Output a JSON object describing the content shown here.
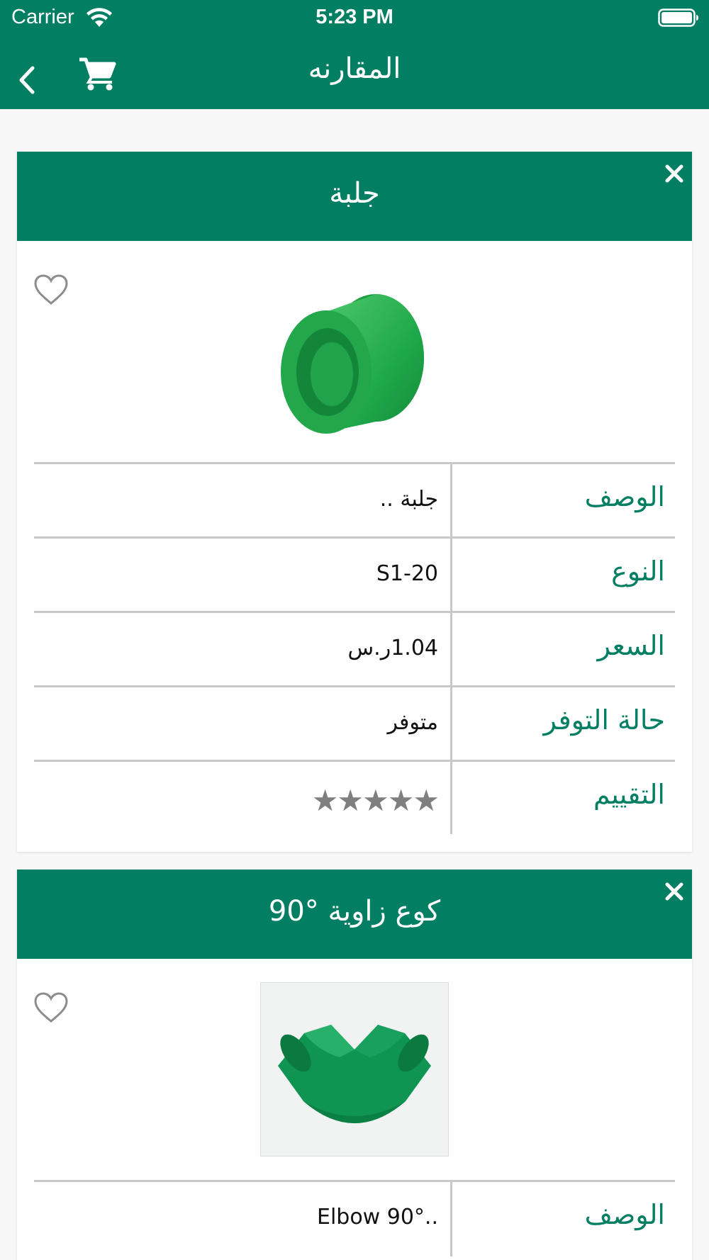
{
  "status_bar": {
    "carrier": "Carrier",
    "time": "5:23 PM"
  },
  "nav": {
    "title": "المقارنه",
    "back_icon": "chevron-left-icon",
    "cart_icon": "cart-icon"
  },
  "colors": {
    "primary": "#027e63",
    "label_text": "#027e63",
    "divider": "#c8c8c8",
    "stars": "#7f7f7f"
  },
  "products": [
    {
      "title": "جلبة",
      "close_icon": "close-icon",
      "favorite_icon": "heart-outline-icon",
      "image": "green pipe coupling",
      "specs": [
        {
          "label": "الوصف",
          "value": "جلبة .."
        },
        {
          "label": "النوع",
          "value": "S1-20"
        },
        {
          "label": "السعر",
          "value": "1.04ر.س"
        },
        {
          "label": "حالة التوفر",
          "value": "متوفر"
        },
        {
          "label": "التقييم",
          "value": "★★★★★",
          "rating": 5
        }
      ]
    },
    {
      "title": "كوع زاوية °90",
      "close_icon": "close-icon",
      "favorite_icon": "heart-outline-icon",
      "image": "green 90 degree elbow fitting",
      "specs": [
        {
          "label": "الوصف",
          "value": "Elbow 90°.."
        }
      ]
    }
  ]
}
